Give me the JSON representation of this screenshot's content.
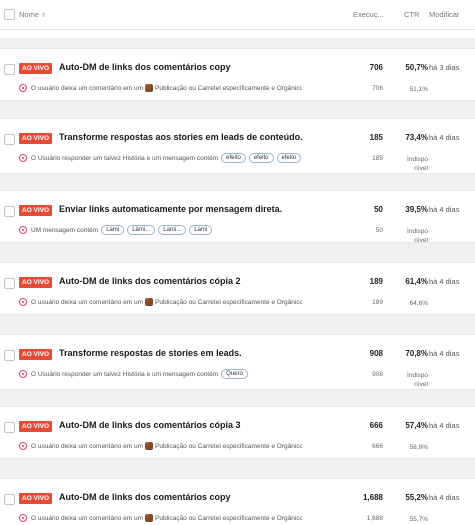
{
  "header": {
    "name_label": "Nome",
    "sort_glyph": "⇕",
    "exec_label": "Execuç...",
    "ctr_label": "CTR",
    "mod_label": "Modificar"
  },
  "status_color": "#e84b35",
  "rows": [
    {
      "status": "AO VIVO",
      "title": "Auto-DM de links dos comentários copy",
      "executions": "706",
      "ctr": "50,7%",
      "modified": "há 3 dias",
      "trigger_pre": "O usuário deixa um comentário em um",
      "trigger_post": "Publicação ou Carretel especificamente e Orgânico",
      "chips": [],
      "sub_exec": "706",
      "sub_ctr": "51,1%"
    },
    {
      "status": "AO VIVO",
      "title": "Transforme respostas aos stories em leads de conteúdo.",
      "executions": "185",
      "ctr": "73,4%",
      "modified": "há 4 dias",
      "trigger_pre": "O Usuário responder um talvez História e um mensagem contém",
      "trigger_post": "",
      "chips": [
        "efeito",
        "efeito",
        "efeito"
      ],
      "sub_exec": "185",
      "sub_ctr": "Indisponível"
    },
    {
      "status": "AO VIVO",
      "title": "Enviar links automaticamente por mensagem direta.",
      "executions": "50",
      "ctr": "39,5%",
      "modified": "há 4 dias",
      "trigger_pre": "UM mensagem contém",
      "trigger_post": "",
      "chips": [
        "Lami",
        "Lâmi...",
        "Lami...",
        "Lami"
      ],
      "sub_exec": "50",
      "sub_ctr": "Indisponível"
    },
    {
      "status": "AO VIVO",
      "title": "Auto-DM de links dos comentários cópia 2",
      "executions": "189",
      "ctr": "61,4%",
      "modified": "há 4 dias",
      "trigger_pre": "O usuário deixa um comentário em um",
      "trigger_post": "Publicação ou Carretel especificamente e Orgânico",
      "chips": [],
      "sub_exec": "189",
      "sub_ctr": "64,6%"
    },
    {
      "status": "AO VIVO",
      "title": "Transforme respostas de stories em leads.",
      "executions": "908",
      "ctr": "70,8%",
      "modified": "há 4 dias",
      "trigger_pre": "O Usuário responder um talvez História e um mensagem contém",
      "trigger_post": "",
      "chips": [
        "Quero"
      ],
      "sub_exec": "908",
      "sub_ctr": "Indisponível"
    },
    {
      "status": "AO VIVO",
      "title": "Auto-DM de links dos comentários cópia 3",
      "executions": "666",
      "ctr": "57,4%",
      "modified": "há 4 dias",
      "trigger_pre": "O usuário deixa um comentário em um",
      "trigger_post": "Publicação ou Carretel especificamente e Orgânico",
      "chips": [],
      "sub_exec": "666",
      "sub_ctr": "58,9%"
    },
    {
      "status": "AO VIVO",
      "title": "Auto-DM de links dos comentários copy",
      "executions": "1,688",
      "ctr": "55,2%",
      "modified": "há 4 dias",
      "trigger_pre": "O usuário deixa um comentário em um",
      "trigger_post": "Publicação ou Carretel especificamente e Orgânico",
      "chips": [],
      "sub_exec": "1,688",
      "sub_ctr": "55,7%"
    }
  ]
}
